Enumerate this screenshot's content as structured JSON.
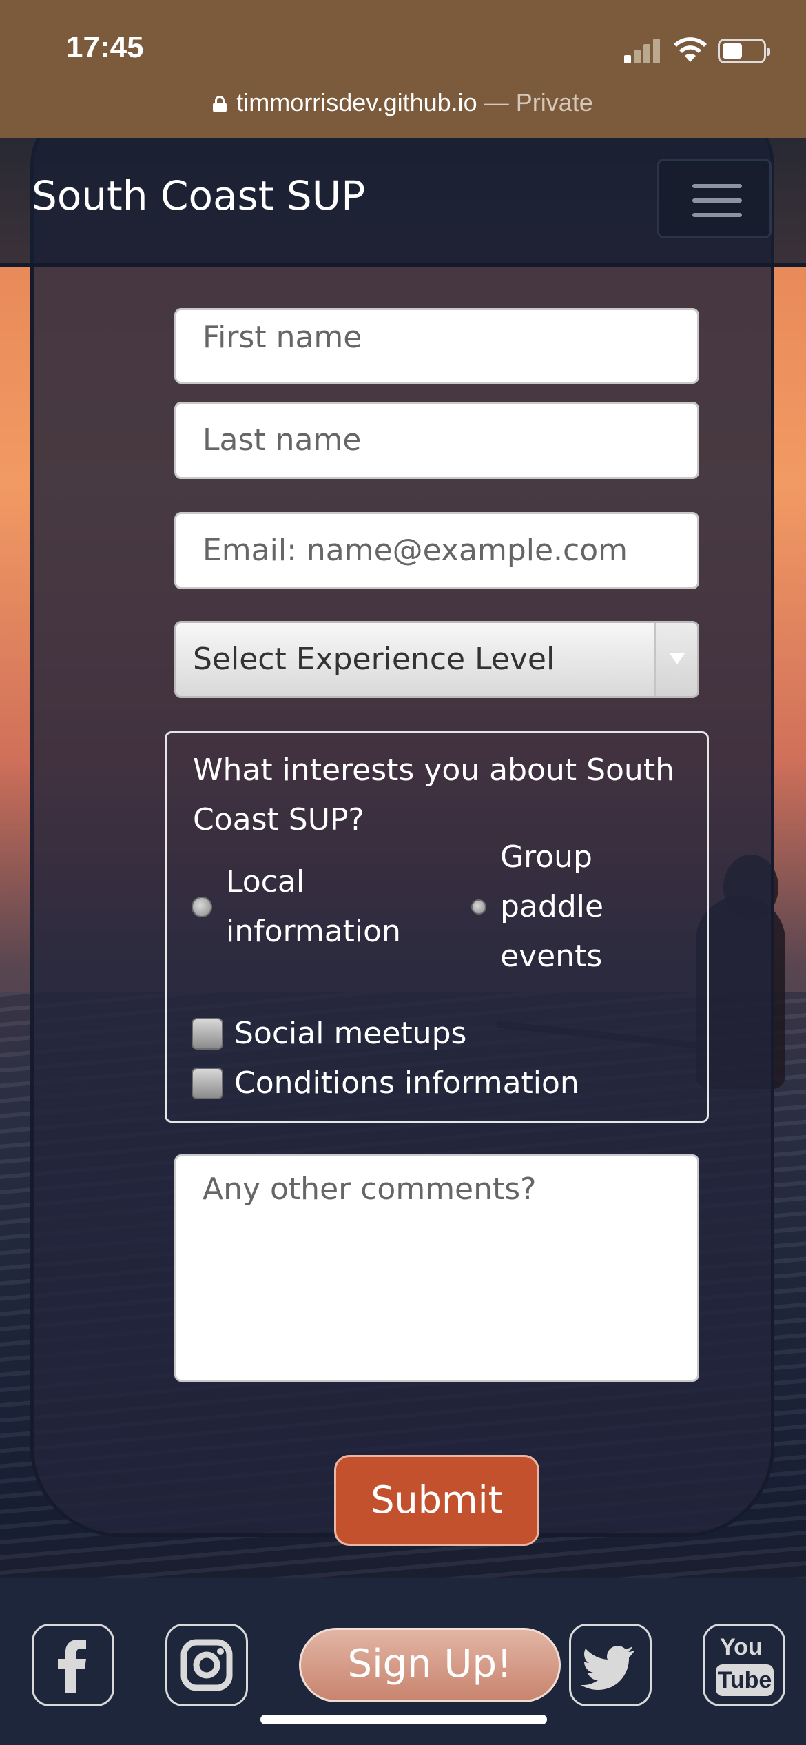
{
  "status_bar": {
    "time": "17:45",
    "url": "timmorrisdev.github.io",
    "url_suffix": " — Private"
  },
  "navbar": {
    "brand": "South Coast SUP",
    "menu_icon": "hamburger-menu-icon"
  },
  "form": {
    "first_name_placeholder": "First name",
    "last_name_placeholder": "Last name",
    "email_placeholder": "Email: name@example.com",
    "experience_select": "Select Experience Level",
    "interests": {
      "legend": "What interests you about South Coast SUP?",
      "radios": [
        {
          "label": "Local information",
          "selected": false
        },
        {
          "label": "Group paddle events",
          "selected": false
        }
      ],
      "checkboxes": [
        {
          "label": "Social meetups",
          "checked": false
        },
        {
          "label": "Conditions information",
          "checked": false
        }
      ]
    },
    "comments_placeholder": "Any other comments?",
    "submit_label": "Submit"
  },
  "footer": {
    "signup_label": "Sign Up!",
    "social_icons": [
      "facebook-icon",
      "instagram-icon",
      "twitter-icon",
      "youtube-icon"
    ],
    "youtube_text": {
      "top": "You",
      "bottom": "Tube"
    }
  },
  "colors": {
    "accent": "#c4512e",
    "navbar": "#161e32",
    "card": "#22243a"
  }
}
